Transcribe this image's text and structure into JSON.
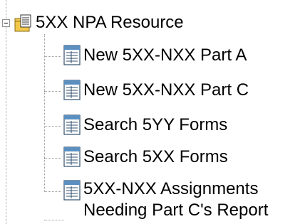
{
  "tree": {
    "root": {
      "label": "5XX NPA Resource",
      "expanded": true,
      "icon": "folder-document-icon"
    },
    "children": [
      {
        "label": "New 5XX-NXX Part A",
        "icon": "document-icon"
      },
      {
        "label": "New 5XX-NXX Part C",
        "icon": "document-icon"
      },
      {
        "label": "Search 5YY Forms",
        "icon": "document-icon"
      },
      {
        "label": "Search 5XX Forms",
        "icon": "document-icon"
      },
      {
        "label_line1": "5XX-NXX Assignments",
        "label_line2": "Needing Part C's Report",
        "icon": "document-icon"
      }
    ]
  },
  "colors": {
    "connector": "#9a9a9a",
    "folder": "#f2c84b",
    "document_blue": "#5b8fbf",
    "document_green": "#7fb27f"
  }
}
